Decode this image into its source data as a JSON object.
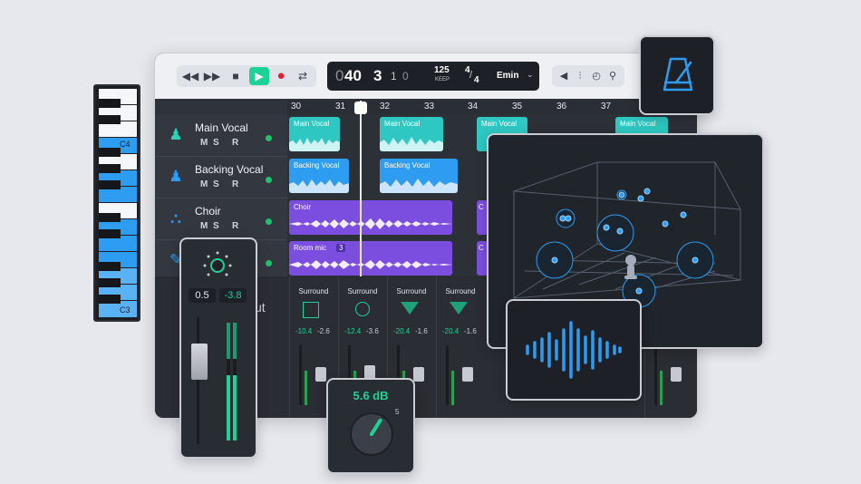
{
  "transport": {
    "counter_prefix": "0",
    "counter_bar": "40",
    "counter_beat": "3",
    "counter_sub": "1",
    "counter_tick": "0",
    "tempo": "125",
    "tempo_label": "KEEP",
    "time_sig_top": "4",
    "time_sig_bottom": "4",
    "key": "Emin"
  },
  "ruler": [
    "30",
    "31",
    "32",
    "33",
    "34",
    "35",
    "36",
    "37"
  ],
  "tracks": [
    {
      "name": "Main Vocal",
      "m": "M",
      "s": "S",
      "r": "R",
      "icon": "singer-icon"
    },
    {
      "name": "Backing Vocal",
      "m": "M",
      "s": "S",
      "r": "R",
      "icon": "singer-icon"
    },
    {
      "name": "Choir",
      "m": "M",
      "s": "S",
      "r": "R",
      "icon": "choir-icon"
    },
    {
      "name": "",
      "m": "",
      "s": "",
      "r": "",
      "icon": "guitar-icon"
    }
  ],
  "clips": {
    "main_vocal_1": "Main Vocal",
    "main_vocal_2": "Main Vocal",
    "main_vocal_3": "Main Vocal",
    "main_vocal_4": "Main Vocal",
    "backing_vocal_1": "Backing Vocal",
    "backing_vocal_2": "Backing Vocal",
    "choir": "Choir",
    "choir_short": "C",
    "room_mic": "Room mic",
    "room_mic_badge": "3",
    "room_mic_short": "C"
  },
  "mixer": {
    "partial_label": "ut",
    "strips": [
      {
        "label": "Surround",
        "val_a": "-10.4",
        "val_b": "-2.6"
      },
      {
        "label": "Surround",
        "val_a": "-12.4",
        "val_b": "-3.6"
      },
      {
        "label": "Surround",
        "val_a": "-20.4",
        "val_b": "-1.6"
      },
      {
        "label": "Surround",
        "val_a": "-20.4",
        "val_b": "-1.6"
      }
    ]
  },
  "keyboard": {
    "label_top": "C4",
    "label_bottom": "C3"
  },
  "channel_panel": {
    "pan_value": "0.5",
    "gain_value": "-3.8"
  },
  "knob_panel": {
    "value": "5.6 dB",
    "max_label": "5",
    "level": 0.62
  },
  "colors": {
    "teal": "#2fc7c2",
    "purple": "#7c4ee0",
    "accent_green": "#1dd296",
    "blue": "#2e9cf0",
    "dark": "#1d2027"
  }
}
